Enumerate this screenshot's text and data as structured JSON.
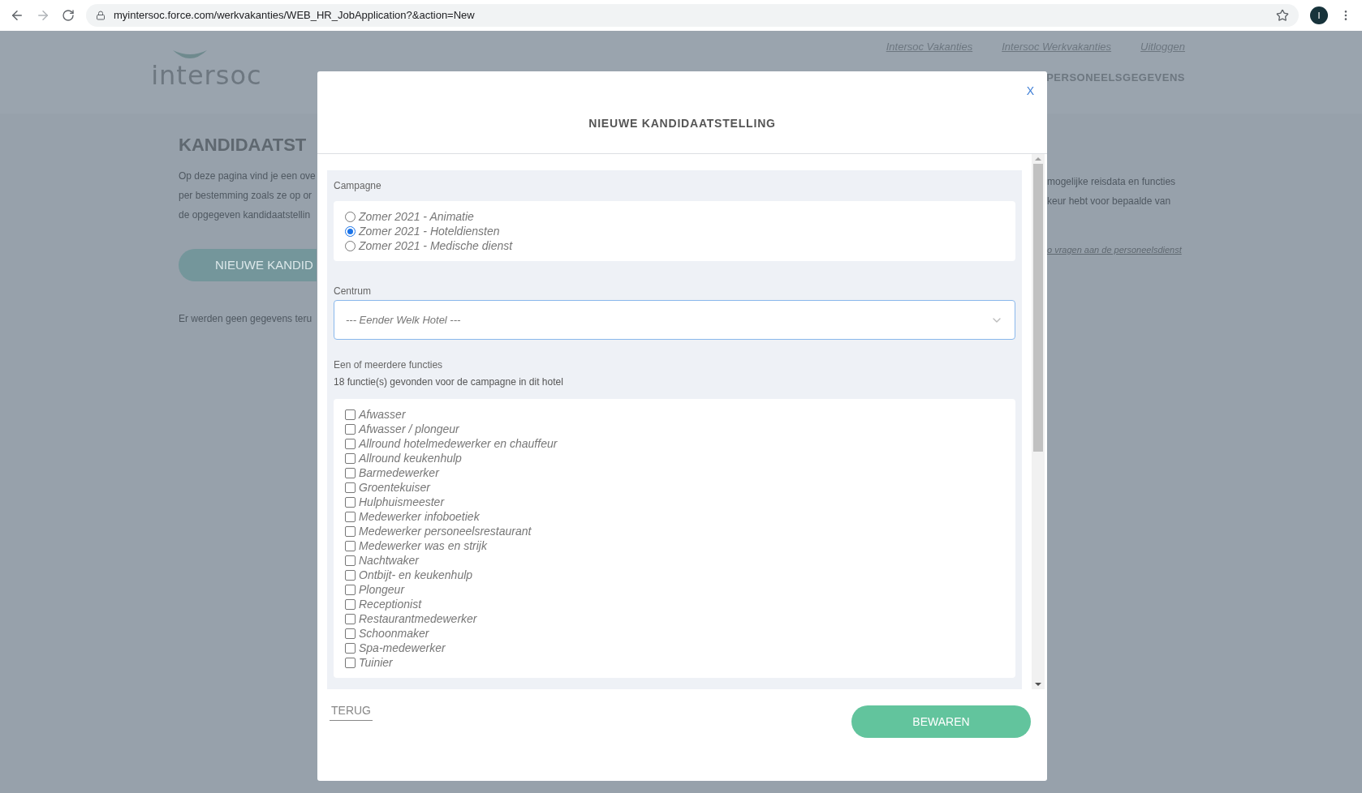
{
  "browser": {
    "url": "myintersoc.force.com/werkvakanties/WEB_HR_JobApplication?&action=New",
    "profile_initial": "I"
  },
  "page": {
    "nav_links": [
      "Intersoc Vakanties",
      "Intersoc Werkvakanties",
      "Uitloggen"
    ],
    "logo": "intersoc",
    "menu_item": "PERSONEELSGEGEVENS",
    "heading": "KANDIDAATST",
    "intro_left": [
      "Op deze pagina vind je een ove",
      "per bestemming zoals ze op or",
      "de opgegeven kandidaatstellin"
    ],
    "intro_right": [
      "mogelijke reisdata en functies",
      "keur hebt voor bepaalde van"
    ],
    "new_button": "NIEUWE KANDID",
    "empty_note": "Er werden geen gegevens teru",
    "staff_link": "o vragen aan de personeelsdienst"
  },
  "modal": {
    "close": "X",
    "title": "NIEUWE KANDIDAATSTELLING",
    "campaign": {
      "label": "Campagne",
      "options": [
        {
          "label": "Zomer 2021 - Animatie",
          "selected": false
        },
        {
          "label": "Zomer 2021 - Hoteldiensten",
          "selected": true
        },
        {
          "label": "Zomer 2021 - Medische dienst",
          "selected": false
        }
      ]
    },
    "center": {
      "label": "Centrum",
      "value": "--- Eender Welk Hotel ---"
    },
    "functions": {
      "label": "Een of meerdere functies",
      "count_note": "18 functie(s) gevonden voor de campagne in dit hotel",
      "options": [
        {
          "label": "Afwasser",
          "checked": false
        },
        {
          "label": "Afwasser / plongeur",
          "checked": false
        },
        {
          "label": "Allround hotelmedewerker en chauffeur",
          "checked": false
        },
        {
          "label": "Allround keukenhulp",
          "checked": false
        },
        {
          "label": "Barmedewerker",
          "checked": false
        },
        {
          "label": "Groentekuiser",
          "checked": false
        },
        {
          "label": "Hulphuismeester",
          "checked": false
        },
        {
          "label": "Medewerker infoboetiek",
          "checked": false
        },
        {
          "label": "Medewerker personeelsrestaurant",
          "checked": false
        },
        {
          "label": "Medewerker was en strijk",
          "checked": false
        },
        {
          "label": "Nachtwaker",
          "checked": false
        },
        {
          "label": "Ontbijt- en keukenhulp",
          "checked": false
        },
        {
          "label": "Plongeur",
          "checked": false
        },
        {
          "label": "Receptionist",
          "checked": false
        },
        {
          "label": "Restaurantmedewerker",
          "checked": false
        },
        {
          "label": "Schoonmaker",
          "checked": false
        },
        {
          "label": "Spa-medewerker",
          "checked": false
        },
        {
          "label": "Tuinier",
          "checked": false
        }
      ]
    },
    "back": "TERUG",
    "save": "BEWAREN"
  }
}
